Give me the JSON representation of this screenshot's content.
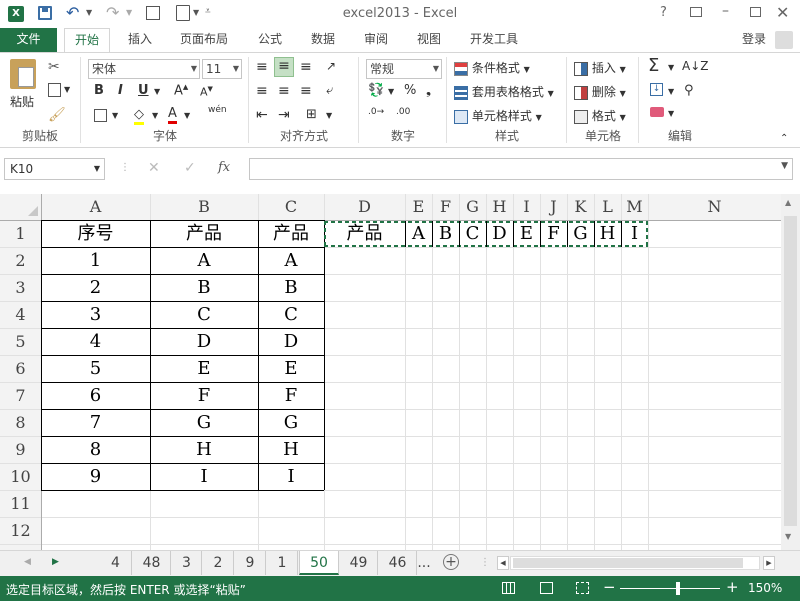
{
  "title": {
    "app_title": "excel2013 - Excel"
  },
  "tabs": {
    "file": "文件",
    "home": "开始",
    "insert": "插入",
    "layout": "页面布局",
    "formulas": "公式",
    "data": "数据",
    "review": "审阅",
    "view": "视图",
    "developer": "开发工具",
    "login": "登录"
  },
  "ribbon": {
    "paste": "粘贴",
    "font_name": "宋体",
    "font_size": "11",
    "bold": "B",
    "italic": "I",
    "underline": "U",
    "wen": "wén",
    "number_format": "常规",
    "percent": "%",
    "cond_format": "条件格式",
    "table_format": "套用表格格式",
    "cell_style": "单元格样式",
    "insert": "插入",
    "delete": "删除",
    "format": "格式",
    "groups": {
      "clipboard": "剪贴板",
      "font": "字体",
      "align": "对齐方式",
      "number": "数字",
      "styles": "样式",
      "cells": "单元格",
      "edit": "编辑"
    }
  },
  "formula": {
    "name_box": "K10",
    "fx": "fx",
    "value": ""
  },
  "columns": [
    "A",
    "B",
    "C",
    "D",
    "E",
    "F",
    "G",
    "H",
    "I",
    "J",
    "K",
    "L",
    "M",
    "N"
  ],
  "rows": [
    "1",
    "2",
    "3",
    "4",
    "5",
    "6",
    "7",
    "8",
    "9",
    "10",
    "11",
    "12"
  ],
  "table": {
    "headers": [
      "序号",
      "产品",
      "产品"
    ],
    "body": [
      [
        "1",
        "A",
        "A"
      ],
      [
        "2",
        "B",
        "B"
      ],
      [
        "3",
        "C",
        "C"
      ],
      [
        "4",
        "D",
        "D"
      ],
      [
        "5",
        "E",
        "E"
      ],
      [
        "6",
        "F",
        "F"
      ],
      [
        "7",
        "G",
        "G"
      ],
      [
        "8",
        "H",
        "H"
      ],
      [
        "9",
        "I",
        "I"
      ]
    ]
  },
  "transposed": [
    "产品",
    "A",
    "B",
    "C",
    "D",
    "E",
    "F",
    "G",
    "H",
    "I"
  ],
  "sheets": [
    "4",
    "48",
    "3",
    "2",
    "9",
    "1",
    "50",
    "49",
    "46",
    "..."
  ],
  "active_sheet": "50",
  "status": {
    "message": "选定目标区域，然后按 ENTER 或选择“粘贴”",
    "zoom": "150%"
  },
  "colors": {
    "excel_green": "#217346",
    "grid": "#e1e1e1",
    "marquee": "#217346"
  }
}
